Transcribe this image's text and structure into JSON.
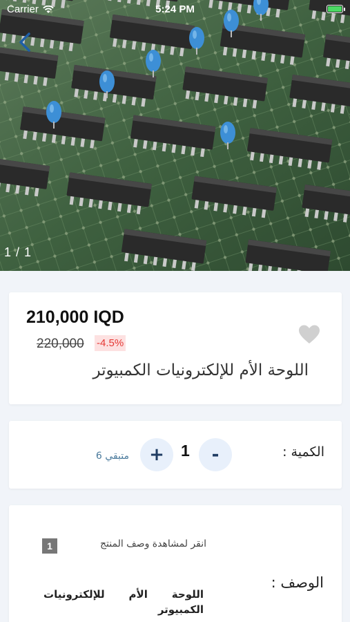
{
  "status_bar": {
    "carrier": "Carrier",
    "time": "5:24 PM"
  },
  "gallery": {
    "pager": "1 / 1"
  },
  "product": {
    "price": "210,000 IQD",
    "old_price": "220,000",
    "discount": "-4.5%",
    "title": "اللوحة الأم للإلكترونيات الكمبيوتر"
  },
  "quantity": {
    "label": "الكمية :",
    "minus": "-",
    "plus": "+",
    "value": "1",
    "remaining": "متبقي 6"
  },
  "description": {
    "hint_number": "1",
    "hint_text": "انقر لمشاهدة وصف المنتج",
    "label": "الوصف :",
    "value": "اللوحة الأم للإلكترونيات الكمبيوتر"
  },
  "colors": {
    "accent": "#1f3c63",
    "discount": "#e53935",
    "background": "#f1f4f9"
  }
}
